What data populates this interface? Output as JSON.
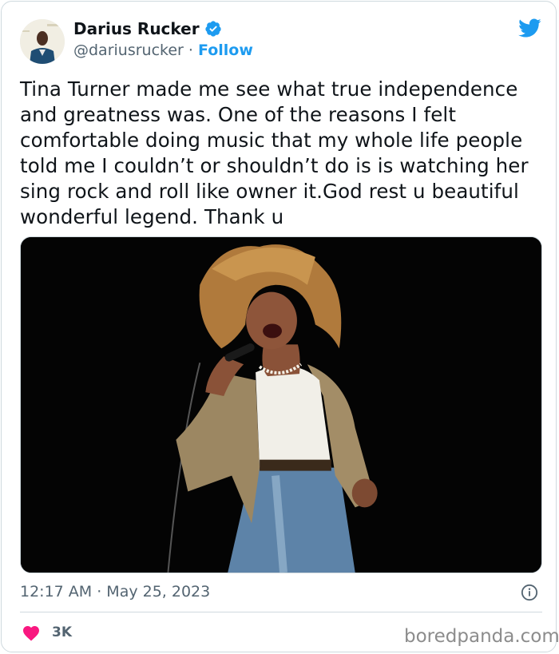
{
  "author": {
    "name": "Darius Rucker",
    "handle": "@dariusrucker",
    "separator": "·",
    "follow_label": "Follow",
    "verified_icon": "verified-badge-icon"
  },
  "tweet": {
    "text": "Tina Turner made me see what true independence and greatness was. One of the reasons I felt comfortable doing music that my whole life people told me I couldn’t or shouldn’t do is is watching her sing rock and roll like owner it.God rest u beautiful wonderful legend. Thank u",
    "timestamp": "12:17 AM · May 25, 2023",
    "likes": "3K"
  },
  "watermark": "boredpanda.com",
  "colors": {
    "accent": "#1d9bf0",
    "heart": "#f91880",
    "muted": "#536471",
    "border": "#cfd9de"
  }
}
